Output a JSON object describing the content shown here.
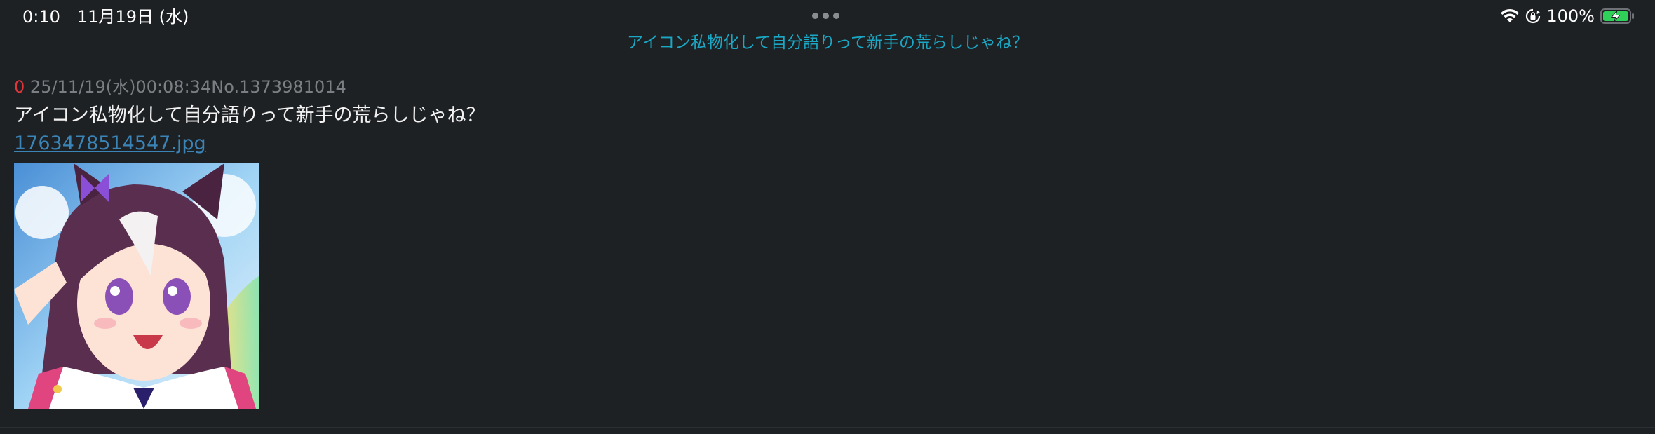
{
  "status_bar": {
    "time_date": "0:10　11月19日 (水)",
    "battery_percent": "100%",
    "icons": [
      "wifi-icon",
      "orientation-lock-icon",
      "battery-charging-icon"
    ]
  },
  "nav": {
    "title": "アイコン私物化して自分語りって新手の荒らしじゃね？"
  },
  "post": {
    "number": "0",
    "datetime": "25/11/19(水)00:08:34",
    "post_no": "No.1373981014",
    "body": "アイコン私物化して自分語りって新手の荒らしじゃね？",
    "file_name": "1763478514547.jpg",
    "image": "anime-girl-thumbnail"
  },
  "colors": {
    "background": "#1e2124",
    "accent_title": "#1aa8c4",
    "post_number": "#e0353b",
    "meta": "#7b7f83",
    "link": "#3a84b8",
    "battery": "#30d158"
  }
}
